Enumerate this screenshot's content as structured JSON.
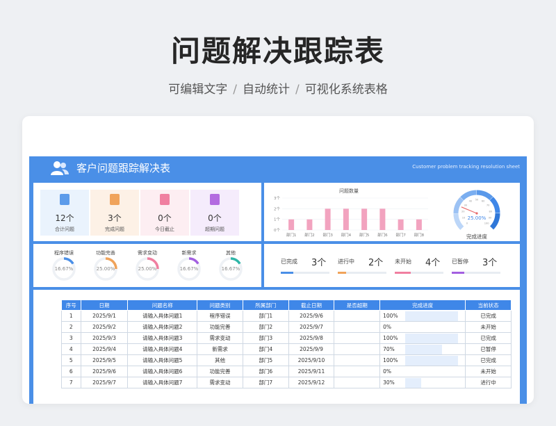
{
  "hero": {
    "title": "问题解决跟踪表",
    "sub": [
      "可编辑文字",
      "自动统计",
      "可视化系统表格"
    ]
  },
  "header": {
    "title": "客户问题跟踪解决表",
    "subtitle_en": "Customer problem tracking resolution sheet"
  },
  "stats": [
    {
      "value": "12个",
      "label": "合计问题",
      "color": "#5b9bea",
      "bg": "#eaf3fd"
    },
    {
      "value": "3个",
      "label": "完成问题",
      "color": "#f0a35a",
      "bg": "#fdf1e6"
    },
    {
      "value": "0个",
      "label": "今日截止",
      "color": "#f07fa0",
      "bg": "#fdeef2"
    },
    {
      "value": "0个",
      "label": "超期问题",
      "color": "#b36be0",
      "bg": "#f5ecfc"
    }
  ],
  "chart_data": {
    "type": "bar",
    "title": "问题数量",
    "categories": [
      "部门1",
      "部门2",
      "部门3",
      "部门4",
      "部门5",
      "部门6",
      "部门7",
      "部门8"
    ],
    "values": [
      1,
      1,
      2,
      2,
      2,
      2,
      1,
      1
    ],
    "ylim": [
      0,
      3
    ],
    "yticks": [
      "0个",
      "1个",
      "2个",
      "3个"
    ],
    "bar_color": "#f2a3bf"
  },
  "gauge": {
    "value": 25,
    "value_label": "25.00%",
    "label": "完成进度",
    "ticks": [
      "0",
      "10",
      "20",
      "30",
      "40",
      "50",
      "60",
      "70",
      "80",
      "90",
      "100"
    ]
  },
  "donuts": [
    {
      "label": "程序错误",
      "value": 16.67,
      "text": "16.67%",
      "color": "#4a8fe7"
    },
    {
      "label": "功能完善",
      "value": 25,
      "text": "25.00%",
      "color": "#f0a35a"
    },
    {
      "label": "需求变动",
      "value": 25,
      "text": "25.00%",
      "color": "#f07fa0"
    },
    {
      "label": "新需求",
      "value": 16.67,
      "text": "16.67%",
      "color": "#a35fe0"
    },
    {
      "label": "其他",
      "value": 16.67,
      "text": "16.67%",
      "color": "#2fb6a7"
    }
  ],
  "status": [
    {
      "label": "已完成",
      "value": "3个",
      "fraction": 0.25,
      "color": "#4a8fe7"
    },
    {
      "label": "进行中",
      "value": "2个",
      "fraction": 0.17,
      "color": "#f0a35a"
    },
    {
      "label": "未开始",
      "value": "4个",
      "fraction": 0.33,
      "color": "#f07fa0"
    },
    {
      "label": "已暂停",
      "value": "3个",
      "fraction": 0.25,
      "color": "#a35fe0"
    }
  ],
  "table": {
    "headers": [
      "序号",
      "日期",
      "问题名称",
      "问题类别",
      "所属部门",
      "截止日期",
      "是否超期",
      "完成进度",
      "当前状态"
    ],
    "rows": [
      {
        "no": "1",
        "date": "2025/9/1",
        "name": "请输入具体问题1",
        "type": "程序错误",
        "dept": "部门1",
        "due": "2025/9/6",
        "overdue": "",
        "progress": "100%",
        "pct": 100,
        "status": "已完成"
      },
      {
        "no": "2",
        "date": "2025/9/2",
        "name": "请输入具体问题2",
        "type": "功能完善",
        "dept": "部门2",
        "due": "2025/9/7",
        "overdue": "",
        "progress": "0%",
        "pct": 0,
        "status": "未开始"
      },
      {
        "no": "3",
        "date": "2025/9/3",
        "name": "请输入具体问题3",
        "type": "需求变动",
        "dept": "部门3",
        "due": "2025/9/8",
        "overdue": "",
        "progress": "100%",
        "pct": 100,
        "status": "已完成"
      },
      {
        "no": "4",
        "date": "2025/9/4",
        "name": "请输入具体问题4",
        "type": "新需求",
        "dept": "部门4",
        "due": "2025/9/9",
        "overdue": "",
        "progress": "70%",
        "pct": 70,
        "status": "已暂停"
      },
      {
        "no": "5",
        "date": "2025/9/5",
        "name": "请输入具体问题5",
        "type": "其他",
        "dept": "部门5",
        "due": "2025/9/10",
        "overdue": "",
        "progress": "100%",
        "pct": 100,
        "status": "已完成"
      },
      {
        "no": "6",
        "date": "2025/9/6",
        "name": "请输入具体问题6",
        "type": "功能完善",
        "dept": "部门6",
        "due": "2025/9/11",
        "overdue": "",
        "progress": "0%",
        "pct": 0,
        "status": "未开始"
      },
      {
        "no": "7",
        "date": "2025/9/7",
        "name": "请输入具体问题7",
        "type": "需求变动",
        "dept": "部门7",
        "due": "2025/9/12",
        "overdue": "",
        "progress": "30%",
        "pct": 30,
        "status": "进行中"
      }
    ]
  }
}
